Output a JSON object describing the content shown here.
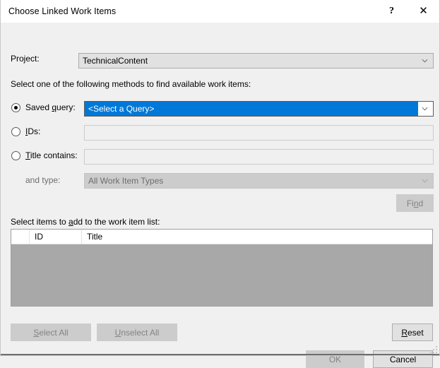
{
  "window": {
    "title": "Choose Linked Work Items",
    "help_button": "?",
    "close_button": "✕"
  },
  "project": {
    "label": "Project:",
    "value": "TechnicalContent"
  },
  "instructions": "Select one of the following methods to find available work items:",
  "methods": {
    "saved_query": {
      "label_pre": "Saved ",
      "label_accel": "q",
      "label_post": "uery:",
      "selected": true,
      "value": "<Select a Query>"
    },
    "ids": {
      "label_accel": "I",
      "label_post": "Ds:",
      "selected": false,
      "value": "",
      "placeholder": ""
    },
    "title_contains": {
      "label_accel": "T",
      "label_post": "itle contains:",
      "selected": false,
      "value": "",
      "placeholder": ""
    },
    "and_type": {
      "label": "and type:",
      "value": "All Work Item Types"
    },
    "find_button": {
      "label_pre": "Fi",
      "label_accel": "n",
      "label_post": "d"
    }
  },
  "list": {
    "caption_pre": "Select items to ",
    "caption_accel": "a",
    "caption_post": "dd to the work item list:",
    "columns": [
      "",
      "ID",
      "Title"
    ],
    "rows": []
  },
  "actions": {
    "select_all": {
      "label_accel": "S",
      "label_post": "elect All"
    },
    "unselect_all": {
      "label_accel": "U",
      "label_post": "nselect All"
    },
    "reset": {
      "label_accel": "R",
      "label_post": "eset"
    },
    "ok": {
      "label": "OK"
    },
    "cancel": {
      "label": "Cancel"
    }
  },
  "colors": {
    "accent": "#0078d7",
    "dialog_bg": "#f0f0f0",
    "control_bg": "#e1e1e1",
    "disabled_bg": "#cccccc",
    "list_bg": "#a8a8a8"
  }
}
